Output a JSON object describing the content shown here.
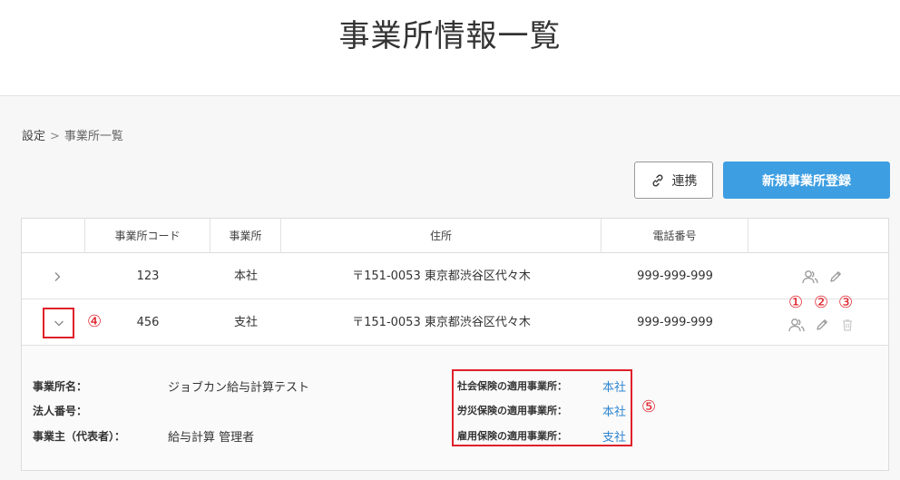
{
  "page": {
    "title": "事業所情報一覧"
  },
  "breadcrumb": {
    "parent": "設定",
    "separator": ">",
    "current": "事業所一覧"
  },
  "toolbar": {
    "link_label": "連携",
    "new_label": "新規事業所登録"
  },
  "table": {
    "headers": [
      "事業所コード",
      "事業所",
      "住所",
      "電話番号"
    ],
    "rows": [
      {
        "code": "123",
        "office": "本社",
        "address": "〒151-0053 東京都渋谷区代々木",
        "phone": "999-999-999"
      },
      {
        "code": "456",
        "office": "支社",
        "address": "〒151-0053 東京都渋谷区代々木",
        "phone": "999-999-999"
      }
    ]
  },
  "detail": {
    "office_name_label": "事業所名：",
    "office_name_value": "ジョブカン給与計算テスト",
    "corp_number_label": "法人番号：",
    "owner_label": "事業主（代表者）：",
    "owner_value": "給与計算 管理者",
    "social_insurance_label": "社会保険の適用事業所：",
    "social_insurance_value": "本社",
    "workers_comp_label": "労災保険の適用事業所：",
    "workers_comp_value": "本社",
    "employment_label": "雇用保険の適用事業所：",
    "employment_value": "支社"
  },
  "annotations": {
    "a1": "①",
    "a2": "②",
    "a3": "③",
    "a4": "④",
    "a5": "⑤"
  },
  "icons": [
    "chevron-right-icon",
    "chevron-down-icon",
    "users-icon",
    "pencil-icon",
    "trash-icon",
    "link-icon"
  ],
  "colors": {
    "primary": "#3d9ee2",
    "highlight": "#e0202a",
    "link": "#2f86d0"
  }
}
